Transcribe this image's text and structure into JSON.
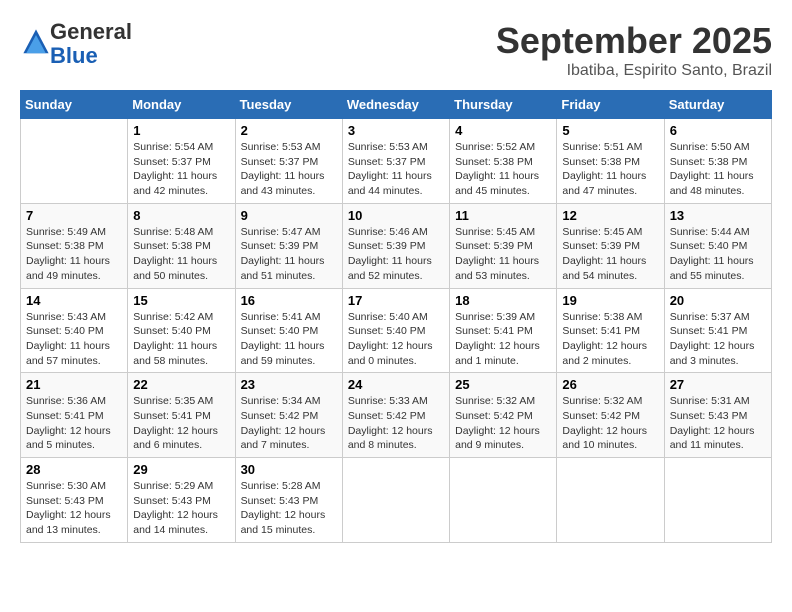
{
  "header": {
    "logo_line1": "General",
    "logo_line2": "Blue",
    "month": "September 2025",
    "location": "Ibatiba, Espirito Santo, Brazil"
  },
  "weekdays": [
    "Sunday",
    "Monday",
    "Tuesday",
    "Wednesday",
    "Thursday",
    "Friday",
    "Saturday"
  ],
  "weeks": [
    [
      {
        "day": "",
        "info": ""
      },
      {
        "day": "1",
        "info": "Sunrise: 5:54 AM\nSunset: 5:37 PM\nDaylight: 11 hours\nand 42 minutes."
      },
      {
        "day": "2",
        "info": "Sunrise: 5:53 AM\nSunset: 5:37 PM\nDaylight: 11 hours\nand 43 minutes."
      },
      {
        "day": "3",
        "info": "Sunrise: 5:53 AM\nSunset: 5:37 PM\nDaylight: 11 hours\nand 44 minutes."
      },
      {
        "day": "4",
        "info": "Sunrise: 5:52 AM\nSunset: 5:38 PM\nDaylight: 11 hours\nand 45 minutes."
      },
      {
        "day": "5",
        "info": "Sunrise: 5:51 AM\nSunset: 5:38 PM\nDaylight: 11 hours\nand 47 minutes."
      },
      {
        "day": "6",
        "info": "Sunrise: 5:50 AM\nSunset: 5:38 PM\nDaylight: 11 hours\nand 48 minutes."
      }
    ],
    [
      {
        "day": "7",
        "info": "Sunrise: 5:49 AM\nSunset: 5:38 PM\nDaylight: 11 hours\nand 49 minutes."
      },
      {
        "day": "8",
        "info": "Sunrise: 5:48 AM\nSunset: 5:38 PM\nDaylight: 11 hours\nand 50 minutes."
      },
      {
        "day": "9",
        "info": "Sunrise: 5:47 AM\nSunset: 5:39 PM\nDaylight: 11 hours\nand 51 minutes."
      },
      {
        "day": "10",
        "info": "Sunrise: 5:46 AM\nSunset: 5:39 PM\nDaylight: 11 hours\nand 52 minutes."
      },
      {
        "day": "11",
        "info": "Sunrise: 5:45 AM\nSunset: 5:39 PM\nDaylight: 11 hours\nand 53 minutes."
      },
      {
        "day": "12",
        "info": "Sunrise: 5:45 AM\nSunset: 5:39 PM\nDaylight: 11 hours\nand 54 minutes."
      },
      {
        "day": "13",
        "info": "Sunrise: 5:44 AM\nSunset: 5:40 PM\nDaylight: 11 hours\nand 55 minutes."
      }
    ],
    [
      {
        "day": "14",
        "info": "Sunrise: 5:43 AM\nSunset: 5:40 PM\nDaylight: 11 hours\nand 57 minutes."
      },
      {
        "day": "15",
        "info": "Sunrise: 5:42 AM\nSunset: 5:40 PM\nDaylight: 11 hours\nand 58 minutes."
      },
      {
        "day": "16",
        "info": "Sunrise: 5:41 AM\nSunset: 5:40 PM\nDaylight: 11 hours\nand 59 minutes."
      },
      {
        "day": "17",
        "info": "Sunrise: 5:40 AM\nSunset: 5:40 PM\nDaylight: 12 hours\nand 0 minutes."
      },
      {
        "day": "18",
        "info": "Sunrise: 5:39 AM\nSunset: 5:41 PM\nDaylight: 12 hours\nand 1 minute."
      },
      {
        "day": "19",
        "info": "Sunrise: 5:38 AM\nSunset: 5:41 PM\nDaylight: 12 hours\nand 2 minutes."
      },
      {
        "day": "20",
        "info": "Sunrise: 5:37 AM\nSunset: 5:41 PM\nDaylight: 12 hours\nand 3 minutes."
      }
    ],
    [
      {
        "day": "21",
        "info": "Sunrise: 5:36 AM\nSunset: 5:41 PM\nDaylight: 12 hours\nand 5 minutes."
      },
      {
        "day": "22",
        "info": "Sunrise: 5:35 AM\nSunset: 5:41 PM\nDaylight: 12 hours\nand 6 minutes."
      },
      {
        "day": "23",
        "info": "Sunrise: 5:34 AM\nSunset: 5:42 PM\nDaylight: 12 hours\nand 7 minutes."
      },
      {
        "day": "24",
        "info": "Sunrise: 5:33 AM\nSunset: 5:42 PM\nDaylight: 12 hours\nand 8 minutes."
      },
      {
        "day": "25",
        "info": "Sunrise: 5:32 AM\nSunset: 5:42 PM\nDaylight: 12 hours\nand 9 minutes."
      },
      {
        "day": "26",
        "info": "Sunrise: 5:32 AM\nSunset: 5:42 PM\nDaylight: 12 hours\nand 10 minutes."
      },
      {
        "day": "27",
        "info": "Sunrise: 5:31 AM\nSunset: 5:43 PM\nDaylight: 12 hours\nand 11 minutes."
      }
    ],
    [
      {
        "day": "28",
        "info": "Sunrise: 5:30 AM\nSunset: 5:43 PM\nDaylight: 12 hours\nand 13 minutes."
      },
      {
        "day": "29",
        "info": "Sunrise: 5:29 AM\nSunset: 5:43 PM\nDaylight: 12 hours\nand 14 minutes."
      },
      {
        "day": "30",
        "info": "Sunrise: 5:28 AM\nSunset: 5:43 PM\nDaylight: 12 hours\nand 15 minutes."
      },
      {
        "day": "",
        "info": ""
      },
      {
        "day": "",
        "info": ""
      },
      {
        "day": "",
        "info": ""
      },
      {
        "day": "",
        "info": ""
      }
    ]
  ]
}
